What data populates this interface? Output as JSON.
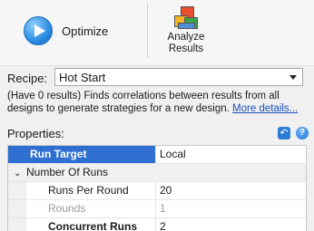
{
  "toolbar": {
    "optimize_label": "Optimize",
    "analyze_label_line1": "Analyze",
    "analyze_label_line2": "Results"
  },
  "recipe": {
    "label": "Recipe:",
    "selected": "Hot Start",
    "description": "(Have 0 results) Finds correlations between results from all designs to generate strategies for a new design. ",
    "more_link": "More details..."
  },
  "properties": {
    "title": "Properties:",
    "rows": [
      {
        "name": "Run Target",
        "value": "Local"
      },
      {
        "name": "Number Of Runs",
        "value": "",
        "chevron": "⌄"
      },
      {
        "name": "Runs Per Round",
        "value": "20"
      },
      {
        "name": "Rounds",
        "value": "1"
      },
      {
        "name": "Concurrent Runs",
        "value": "2"
      }
    ]
  },
  "colors": {
    "selection": "#2f6fd2",
    "link": "#1a4fc0"
  }
}
